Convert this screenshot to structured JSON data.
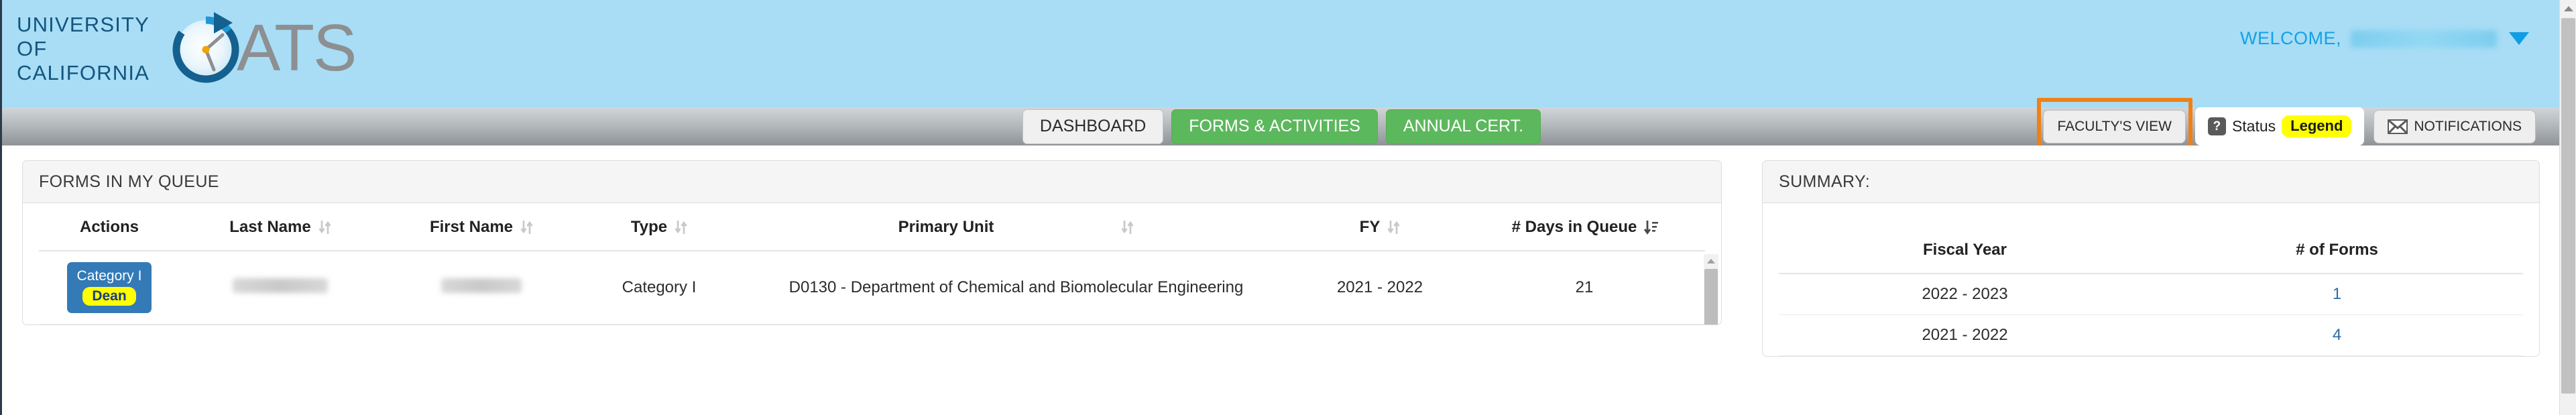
{
  "header": {
    "brand_line1": "UNIVERSITY",
    "brand_line2": "OF",
    "brand_line3": "CALIFORNIA",
    "app_name": "ATS",
    "logo_icon": "clock-arrow-icon",
    "welcome_label": "WELCOME,",
    "welcome_name": "",
    "caret_icon": "chevron-down-icon",
    "background_color": "#a8ddf5",
    "brand_color": "#12557f",
    "welcome_color": "#12a2e8"
  },
  "navbar": {
    "tabs": [
      {
        "label": "DASHBOARD",
        "active": true
      },
      {
        "label": "FORMS & ACTIVITIES",
        "active": false
      },
      {
        "label": "ANNUAL CERT.",
        "active": false
      }
    ],
    "faculty_view": {
      "label": "FACULTY'S VIEW",
      "highlight_color": "#f08016",
      "highlighted": true
    },
    "status_legend": {
      "icon": "question-mark-icon",
      "label": "Status",
      "badge": "Legend",
      "badge_color": "#ffff00"
    },
    "notifications": {
      "icon": "envelope-icon",
      "label": "NOTIFICATIONS"
    },
    "active_tab_color": "#f0f0f0",
    "tab_color": "#5cb85c"
  },
  "queue_card": {
    "title": "FORMS IN MY QUEUE",
    "columns": [
      {
        "label": "Actions",
        "sortable": false,
        "sort_state": "none"
      },
      {
        "label": "Last Name",
        "sortable": true,
        "sort_state": "none"
      },
      {
        "label": "First Name",
        "sortable": true,
        "sort_state": "none"
      },
      {
        "label": "Type",
        "sortable": true,
        "sort_state": "none"
      },
      {
        "label": "Primary Unit",
        "sortable": true,
        "sort_state": "none"
      },
      {
        "label": "FY",
        "sortable": true,
        "sort_state": "none"
      },
      {
        "label": "# Days in Queue",
        "sortable": true,
        "sort_state": "desc"
      }
    ],
    "rows": [
      {
        "action_label": "Category I",
        "action_badge": "Dean",
        "last_name": "",
        "first_name": "",
        "type": "Category I",
        "primary_unit": "D0130 - Department of Chemical and Biomolecular Engineering",
        "fy": "2021 - 2022",
        "days_in_queue": "21"
      }
    ],
    "action_button_color": "#337ab7",
    "badge_color": "#ffff00"
  },
  "summary_card": {
    "title": "SUMMARY:",
    "columns": [
      "Fiscal Year",
      "# of Forms"
    ],
    "rows": [
      {
        "fiscal_year": "2022 - 2023",
        "forms": "1"
      },
      {
        "fiscal_year": "2021 - 2022",
        "forms": "4"
      }
    ],
    "link_color": "#2f6ca8"
  }
}
